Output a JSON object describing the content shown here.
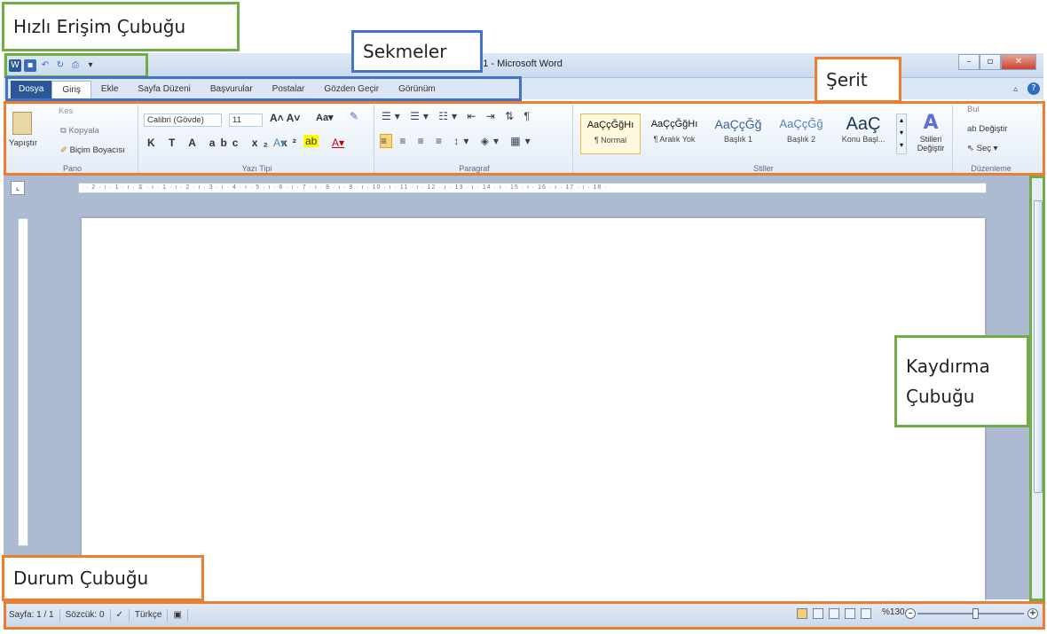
{
  "annotations": {
    "quick_access": "Hızlı Erişim Çubuğu",
    "tabs": "Sekmeler",
    "ribbon": "Şerit",
    "scrollbar_line1": "Kaydırma",
    "scrollbar_line2": "Çubuğu",
    "statusbar": "Durum Çubuğu"
  },
  "window": {
    "title": "ge1 - Microsoft Word"
  },
  "tabs": [
    "Dosya",
    "Giriş",
    "Ekle",
    "Sayfa Düzeni",
    "Başvurular",
    "Postalar",
    "Gözden Geçir",
    "Görünüm"
  ],
  "ribbon": {
    "pano": {
      "label": "Pano",
      "paste": "Yapıştır",
      "cut": "Kes",
      "copy": "Kopyala",
      "format_painter": "Biçim Boyacısı"
    },
    "font": {
      "label": "Yazı Tipi",
      "font_name": "Calibri (Gövde)",
      "font_size": "11"
    },
    "paragraph": {
      "label": "Paragraf"
    },
    "styles": {
      "label": "Stiller",
      "items": [
        {
          "sample": "AaÇçĞğHı",
          "name": "¶ Normal"
        },
        {
          "sample": "AaÇçĞğHı",
          "name": "¶ Aralık Yok"
        },
        {
          "sample": "AaÇçĞğ",
          "name": "Başlık 1"
        },
        {
          "sample": "AaÇçĞğ",
          "name": "Başlık 2"
        },
        {
          "sample": "AaÇ",
          "name": "Konu Başl..."
        }
      ],
      "change_styles": "Stilleri Değiştir"
    },
    "editing": {
      "label": "Düzenleme",
      "find": "Bul",
      "replace": "Değiştir",
      "select": "Seç"
    }
  },
  "ruler_text": "· 2 · ı · 1 · ı · ⧖ · ı · 1 · ı · 2 · ı · 3 · ı · 4 · ı · 5 · ı · 6 · ı · 7 · ı · 8 · ı · 9 · ı · 10 · ı · 11 · ı · 12 · ı · 13 · ı · 14 · ı · 15 · ı · 16 · ı · 17 · ı · 18 ·",
  "status": {
    "page": "Sayfa: 1 / 1",
    "words": "Sözcük: 0",
    "language": "Türkçe",
    "zoom": "%130",
    "zoom_percent": 130
  }
}
